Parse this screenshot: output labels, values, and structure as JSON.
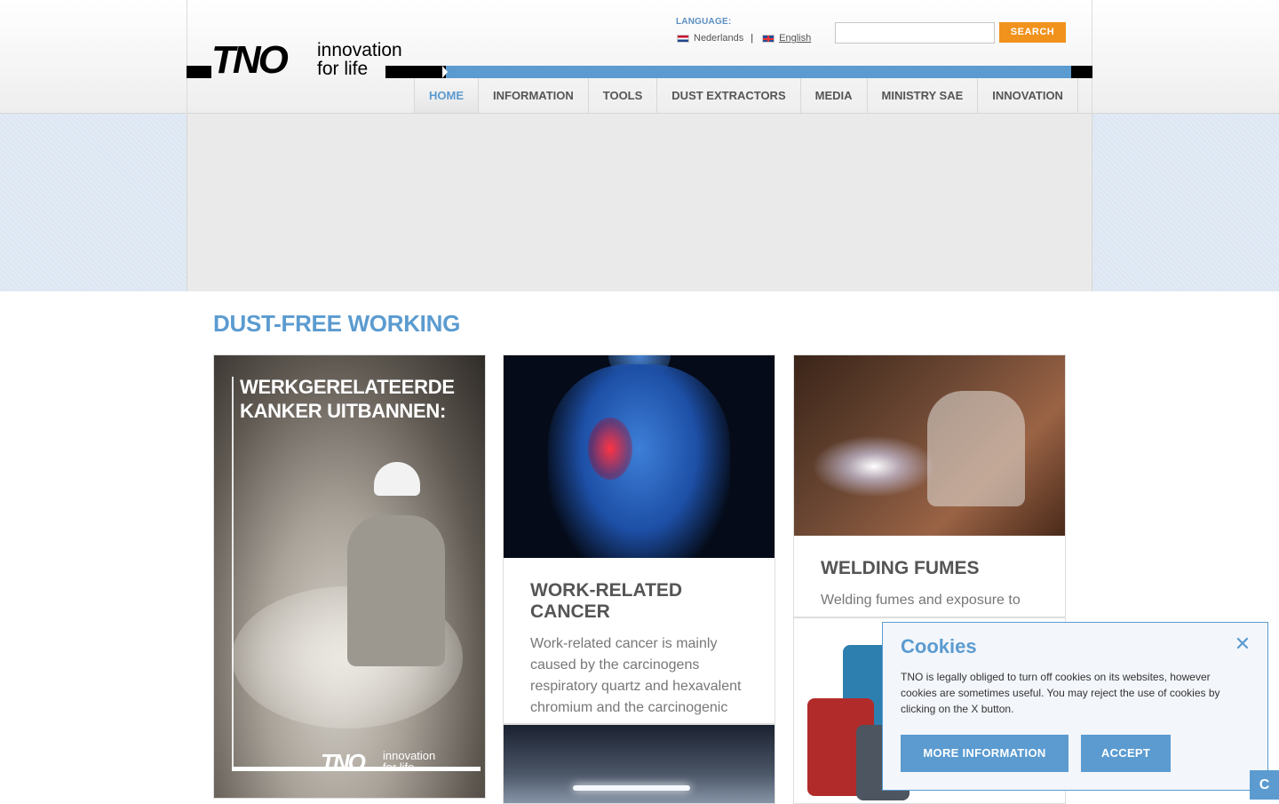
{
  "header": {
    "logo": {
      "wordmark": "TNO",
      "tagline_line1": "innovation",
      "tagline_line2": "for life"
    },
    "language": {
      "label": "LANGUAGE:",
      "options": [
        {
          "label": "Nederlands",
          "flag": "nl-flag-icon"
        },
        {
          "label": "English",
          "flag": "uk-flag-icon"
        }
      ]
    },
    "search": {
      "placeholder": "",
      "value": "",
      "button_label": "SEARCH"
    },
    "nav": [
      {
        "label": "HOME",
        "active": true
      },
      {
        "label": "INFORMATION"
      },
      {
        "label": "TOOLS"
      },
      {
        "label": "DUST EXTRACTORS"
      },
      {
        "label": "MEDIA"
      },
      {
        "label": "MINISTRY SAE"
      },
      {
        "label": "INNOVATION"
      }
    ]
  },
  "main": {
    "title": "DUST-FREE WORKING",
    "cards": {
      "poster": {
        "headline_line1": "WERKGERELATEERDE",
        "headline_line2": "KANKER UITBANNEN:",
        "logo_wordmark": "TNO",
        "logo_tagline_line1": "innovation",
        "logo_tagline_line2": "for life"
      },
      "cancer": {
        "title": "WORK-RELATED CANCER",
        "text": "Work-related cancer is mainly caused by the carcinogens respiratory quartz and hexavalent chromium and the carcinogenic"
      },
      "welding": {
        "title": "WELDING FUMES",
        "text": "Welding fumes and exposure to"
      }
    }
  },
  "cookies": {
    "title": "Cookies",
    "close_icon": "close-icon",
    "text": "TNO is legally obliged to turn off cookies on its websites, however cookies are sometimes useful. You may reject the use of cookies by clicking on the X button.",
    "more_info_label": "MORE INFORMATION",
    "accept_label": "ACCEPT"
  },
  "corner_tab": {
    "label": "C"
  },
  "colors": {
    "accent_blue": "#5b9bd0",
    "search_orange": "#f0921c",
    "heading_gray": "#555555"
  }
}
